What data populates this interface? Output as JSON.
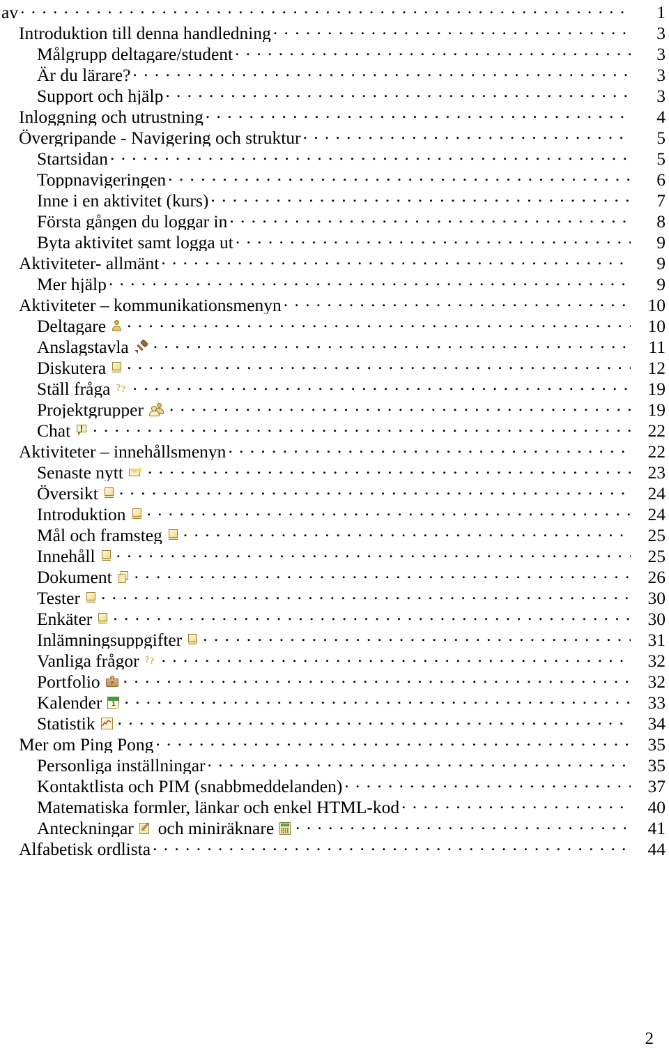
{
  "document": {
    "type": "table-of-contents",
    "language": "sv",
    "page_number": "2"
  },
  "toc": {
    "entries": [
      {
        "label": "av",
        "page": "1",
        "level": 0,
        "icons": []
      },
      {
        "label": "Introduktion till denna handledning",
        "page": "3",
        "level": 1,
        "icons": []
      },
      {
        "label": "Målgrupp deltagare/student",
        "page": "3",
        "level": 2,
        "icons": []
      },
      {
        "label": "Är du lärare?",
        "page": "3",
        "level": 2,
        "icons": []
      },
      {
        "label": "Support och hjälp",
        "page": "3",
        "level": 2,
        "icons": []
      },
      {
        "label": "Inloggning och utrustning",
        "page": "4",
        "level": 1,
        "icons": []
      },
      {
        "label": "Övergripande - Navigering och struktur",
        "page": "5",
        "level": 1,
        "icons": []
      },
      {
        "label": "Startsidan",
        "page": "5",
        "level": 2,
        "icons": []
      },
      {
        "label": "Toppnavigeringen",
        "page": "6",
        "level": 2,
        "icons": []
      },
      {
        "label": "Inne i en aktivitet (kurs)",
        "page": "7",
        "level": 2,
        "icons": []
      },
      {
        "label": "Första gången du loggar in",
        "page": "8",
        "level": 2,
        "icons": []
      },
      {
        "label": "Byta aktivitet samt logga ut",
        "page": "9",
        "level": 2,
        "icons": []
      },
      {
        "label": "Aktiviteter- allmänt",
        "page": "9",
        "level": 1,
        "icons": []
      },
      {
        "label": "Mer hjälp",
        "page": "9",
        "level": 2,
        "icons": []
      },
      {
        "label": "Aktiviteter – kommunikationsmenyn",
        "page": "10",
        "level": 1,
        "icons": []
      },
      {
        "label": "Deltagare",
        "page": "10",
        "level": 2,
        "icons": [
          "person-icon"
        ]
      },
      {
        "label": "Anslagstavla",
        "page": "11",
        "level": 2,
        "icons": [
          "pushpin-icon"
        ]
      },
      {
        "label": "Diskutera",
        "page": "12",
        "level": 2,
        "icons": [
          "book-icon"
        ]
      },
      {
        "label": "Ställ fråga",
        "page": "19",
        "level": 2,
        "icons": [
          "question-marks-icon"
        ]
      },
      {
        "label": "Projektgrupper",
        "page": "19",
        "level": 2,
        "icons": [
          "group-icon"
        ]
      },
      {
        "label": "Chat",
        "page": "22",
        "level": 2,
        "icons": [
          "chat-bubble-icon"
        ]
      },
      {
        "label": "Aktiviteter – innehållsmenyn",
        "page": "22",
        "level": 1,
        "icons": []
      },
      {
        "label": "Senaste nytt",
        "page": "23",
        "level": 2,
        "icons": [
          "news-envelope-star-icon"
        ]
      },
      {
        "label": "Översikt",
        "page": "24",
        "level": 2,
        "icons": [
          "book-icon"
        ]
      },
      {
        "label": "Introduktion",
        "page": "24",
        "level": 2,
        "icons": [
          "book-icon"
        ]
      },
      {
        "label": "Mål och framsteg",
        "page": "25",
        "level": 2,
        "icons": [
          "book-icon"
        ]
      },
      {
        "label": "Innehåll",
        "page": "25",
        "level": 2,
        "icons": [
          "book-icon"
        ]
      },
      {
        "label": "Dokument",
        "page": "26",
        "level": 2,
        "icons": [
          "documents-icon"
        ]
      },
      {
        "label": "Tester",
        "page": "30",
        "level": 2,
        "icons": [
          "book-icon"
        ]
      },
      {
        "label": "Enkäter",
        "page": "30",
        "level": 2,
        "icons": [
          "book-icon"
        ]
      },
      {
        "label": "Inlämningsuppgifter",
        "page": "31",
        "level": 2,
        "icons": [
          "book-icon"
        ]
      },
      {
        "label": "Vanliga frågor",
        "page": "32",
        "level": 2,
        "icons": [
          "question-marks-icon"
        ]
      },
      {
        "label": "Portfolio",
        "page": "32",
        "level": 2,
        "icons": [
          "briefcase-icon"
        ]
      },
      {
        "label": "Kalender",
        "page": "33",
        "level": 2,
        "icons": [
          "calendar-icon"
        ]
      },
      {
        "label": "Statistik",
        "page": "34",
        "level": 2,
        "icons": [
          "statistics-chart-icon"
        ]
      },
      {
        "label": "Mer om Ping Pong",
        "page": "35",
        "level": 1,
        "icons": []
      },
      {
        "label": "Personliga inställningar",
        "page": "35",
        "level": 2,
        "icons": []
      },
      {
        "label": "Kontaktlista och PIM (snabbmeddelanden)",
        "page": "37",
        "level": 2,
        "icons": []
      },
      {
        "label": "Matematiska formler, länkar och enkel HTML-kod",
        "page": "40",
        "level": 2,
        "icons": []
      },
      {
        "label": "Anteckningar",
        "label_suffix": "och miniräknare",
        "page": "41",
        "level": 2,
        "icons": [
          "notepad-pencil-icon"
        ],
        "suffix_icons": [
          "calculator-icon"
        ]
      },
      {
        "label": "Alfabetisk ordlista",
        "page": "44",
        "level": 1,
        "icons": []
      }
    ]
  },
  "calendar_icon": {
    "day": "1"
  }
}
